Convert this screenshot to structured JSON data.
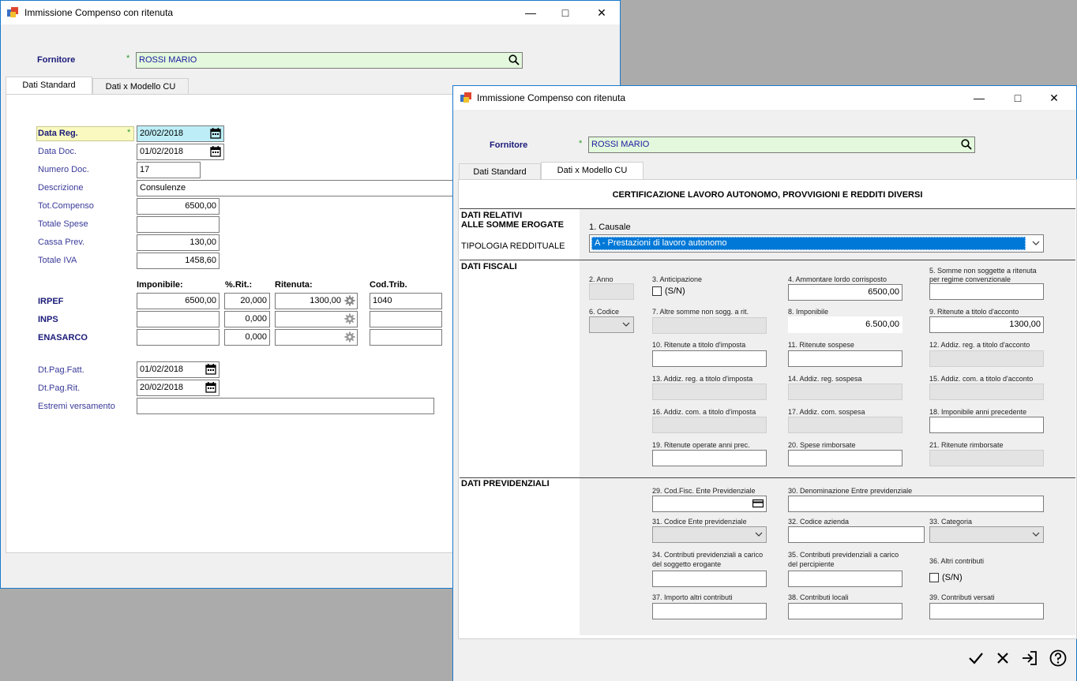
{
  "win1": {
    "title": "Immissione Compenso con ritenuta",
    "fornitore_label": "Fornitore",
    "fornitore_value": "ROSSI MARIO",
    "tabs": [
      "Dati Standard",
      "Dati x Modello CU"
    ],
    "fields": {
      "data_reg_label": "Data Reg.",
      "data_reg_value": "20/02/2018",
      "data_doc_label": "Data Doc.",
      "data_doc_value": "01/02/2018",
      "numero_doc_label": "Numero Doc.",
      "numero_doc_value": "17",
      "descrizione_label": "Descrizione",
      "descrizione_value": "Consulenze",
      "tot_compenso_label": "Tot.Compenso",
      "tot_compenso_value": "6500,00",
      "totale_spese_label": "Totale Spese",
      "totale_spese_value": "",
      "cassa_prev_label": "Cassa Prev.",
      "cassa_prev_value": "130,00",
      "totale_iva_label": "Totale IVA",
      "totale_iva_value": "1458,60"
    },
    "grid": {
      "headers": [
        "Imponibile:",
        "%.Rit.:",
        "Ritenuta:",
        "Cod.Trib."
      ],
      "rows": [
        {
          "label": "IRPEF",
          "imponibile": "6500,00",
          "rit": "20,000",
          "ritenuta": "1300,00",
          "cod": "1040"
        },
        {
          "label": "INPS",
          "imponibile": "",
          "rit": "0,000",
          "ritenuta": "",
          "cod": ""
        },
        {
          "label": "ENASARCO",
          "imponibile": "",
          "rit": "0,000",
          "ritenuta": "",
          "cod": ""
        }
      ]
    },
    "dt_pag_fatt_label": "Dt.Pag.Fatt.",
    "dt_pag_fatt_value": "01/02/2018",
    "dt_pag_rit_label": "Dt.Pag.Rit.",
    "dt_pag_rit_value": "20/02/2018",
    "estremi_label": "Estremi versamento",
    "estremi_value": ""
  },
  "win2": {
    "title": "Immissione Compenso con ritenuta",
    "fornitore_label": "Fornitore",
    "fornitore_value": "ROSSI MARIO",
    "tabs": [
      "Dati Standard",
      "Dati x Modello CU"
    ],
    "heading": "CERTIFICAZIONE LAVORO AUTONOMO, PROVVIGIONI E REDDITI DIVERSI",
    "sec1_line1": "DATI RELATIVI",
    "sec1_line2": "ALLE SOMME EROGATE",
    "tipologia_label": "TIPOLOGIA REDDITUALE",
    "causale_label": "1. Causale",
    "causale_value": "A - Prestazioni di lavoro autonomo",
    "sec2": "DATI FISCALI",
    "f2_label": "2. Anno",
    "f3_label": "3. Anticipazione",
    "f3_chk": "(S/N)",
    "f4_label": "4. Ammontare lordo corrisposto",
    "f4_value": "6500,00",
    "f5_label1": "5. Somme non soggette a ritenuta",
    "f5_label2": "per regime convenzionale",
    "f6_label": "6. Codice",
    "f7_label": "7. Altre somme non sogg. a rit.",
    "f8_label": "8. Imponibile",
    "f8_value": "6.500,00",
    "f9_label": "9. Ritenute a titolo d'acconto",
    "f9_value": "1300,00",
    "f10_label": "10. Ritenute a titolo d'imposta",
    "f11_label": "11. Ritenute sospese",
    "f12_label": "12. Addiz. reg. a titolo d'acconto",
    "f13_label": "13. Addiz. reg. a titolo d'imposta",
    "f14_label": "14. Addiz. reg. sospesa",
    "f15_label": "15. Addiz. com. a titolo d'acconto",
    "f16_label": "16. Addiz. com. a titolo d'imposta",
    "f17_label": "17. Addiz. com. sospesa",
    "f18_label": "18. Imponibile anni precedente",
    "f19_label": "19. Ritenute operate anni prec.",
    "f20_label": "20. Spese rimborsate",
    "f21_label": "21. Ritenute rimborsate",
    "sec3": "DATI PREVIDENZIALI",
    "f29_label": "29. Cod.Fisc. Ente Previdenziale",
    "f30_label": "30. Denominazione Entre previdenziale",
    "f31_label": "31. Codice Ente previdenziale",
    "f32_label": "32. Codice azienda",
    "f33_label": "33. Categoria",
    "f34_label1": "34. Contributi previdenziali a carico",
    "f34_label2": "del soggetto erogante",
    "f35_label1": "35. Contributi previdenziali a carico",
    "f35_label2": "del percipiente",
    "f36_label": "36. Altri contributi",
    "f36_chk": "(S/N)",
    "f37_label": "37. Importo altri contributi",
    "f38_label": "38. Contributi locali",
    "f39_label": "39. Contributi versati"
  },
  "colors": {
    "titlebar_border": "#1979ca",
    "green_field": "#e3f8dc",
    "cyan_field": "#bdeef7",
    "yellow_label": "#fafac0",
    "selection": "#0078d7"
  }
}
